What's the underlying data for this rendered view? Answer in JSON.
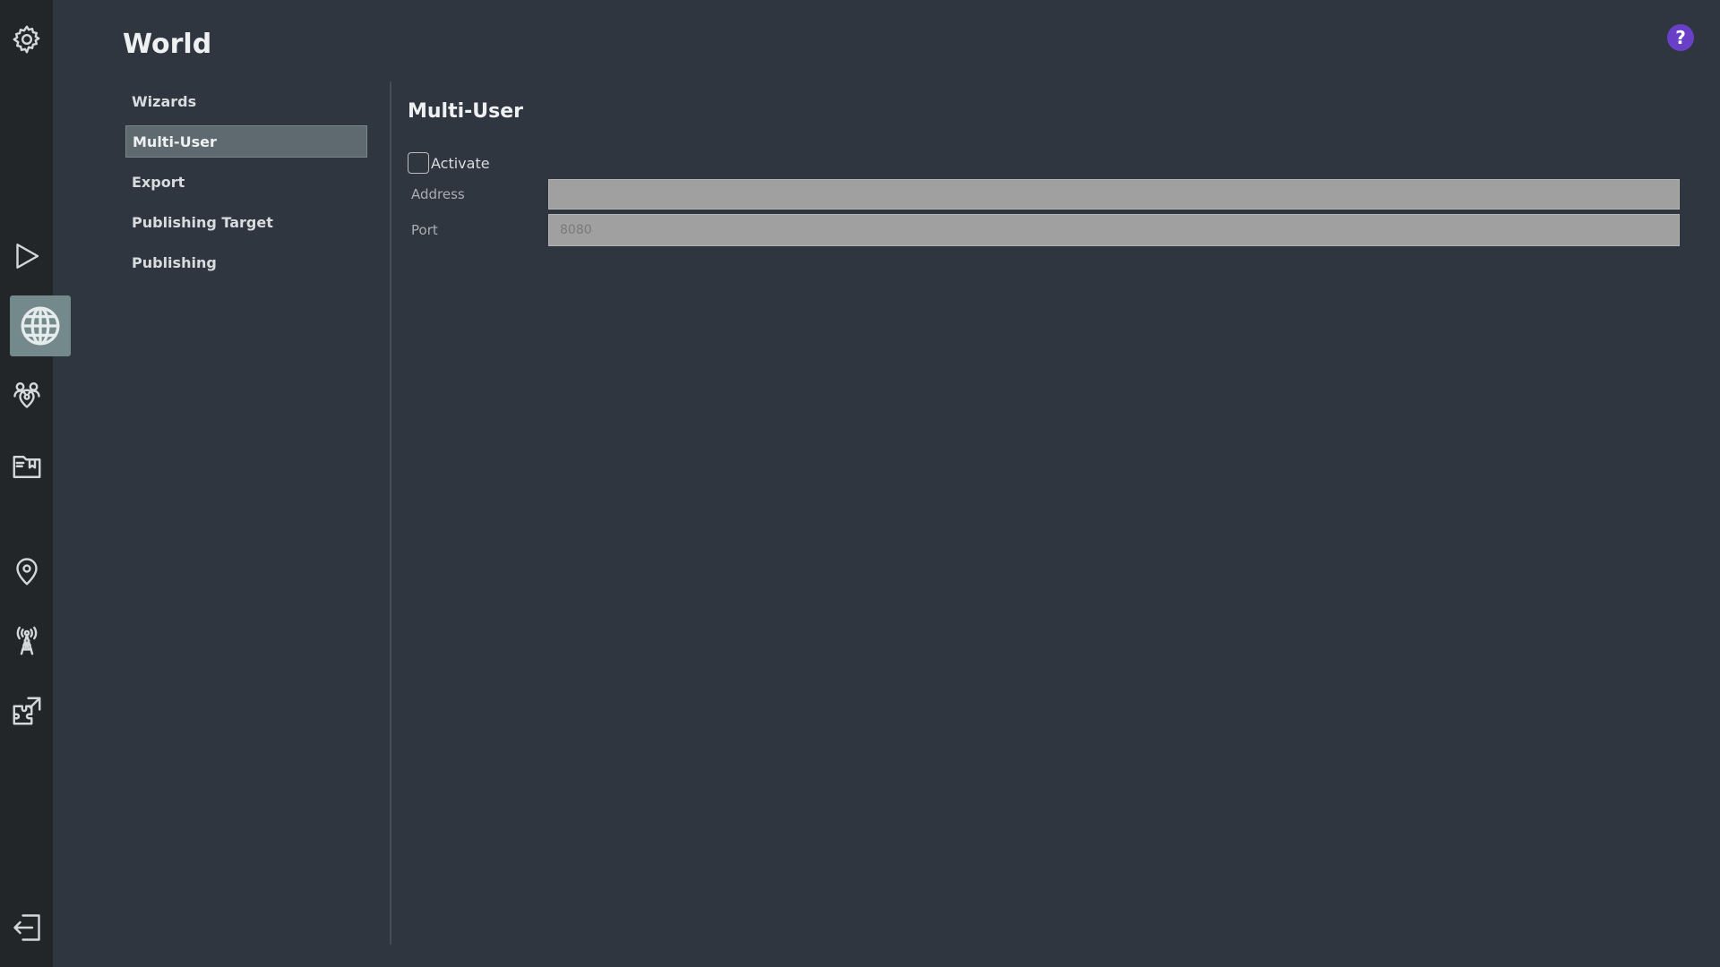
{
  "page": {
    "title": "World"
  },
  "rail": {
    "items": [
      {
        "icon": "gear-icon"
      },
      {
        "icon": "play-icon"
      },
      {
        "icon": "globe-icon",
        "active": true
      },
      {
        "icon": "people-location-icon"
      },
      {
        "icon": "folder-bookmark-icon"
      },
      {
        "icon": "map-pin-icon"
      },
      {
        "icon": "antenna-tower-icon"
      },
      {
        "icon": "puzzle-external-icon"
      },
      {
        "icon": "logout-icon"
      }
    ]
  },
  "help": {
    "label": "?",
    "color": "#6a3fc7"
  },
  "subnav": {
    "items": [
      {
        "label": "Wizards"
      },
      {
        "label": "Multi-User",
        "active": true
      },
      {
        "label": "Export"
      },
      {
        "label": "Publishing Target"
      },
      {
        "label": "Publishing"
      }
    ]
  },
  "section": {
    "title": "Multi-User",
    "activate_label": "Activate",
    "activate_checked": false,
    "address": {
      "label": "Address",
      "value": "",
      "placeholder": ""
    },
    "port": {
      "label": "Port",
      "value": "",
      "placeholder": "8080"
    }
  }
}
